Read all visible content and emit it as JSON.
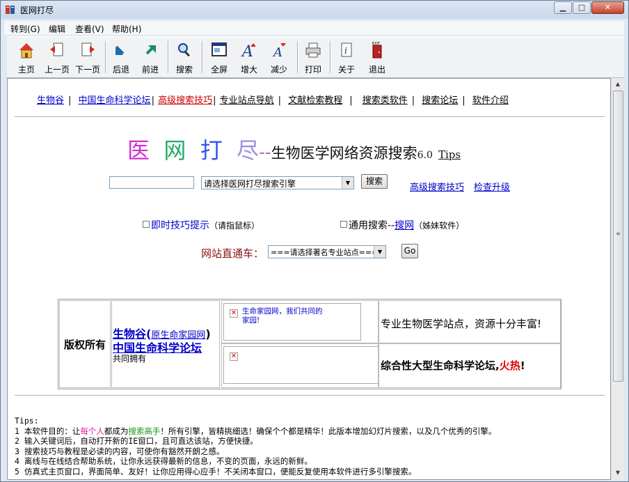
{
  "window": {
    "title": "医网打尽"
  },
  "menu": [
    "转到(G)",
    "编辑",
    "查看(V)",
    "帮助(H)"
  ],
  "toolbar": [
    "主页",
    "上一页",
    "下一页",
    "后退",
    "前进",
    "搜索",
    "全屏",
    "增大",
    "减少",
    "打印",
    "关于",
    "退出"
  ],
  "nav": [
    "生物谷",
    "中国生命科学论坛",
    "高级搜索技巧",
    "专业站点导航",
    "文献检索教程",
    "搜索类软件",
    "搜索论坛",
    "软件介绍"
  ],
  "logo": {
    "c1": "医",
    "c2": "网",
    "c3": "打",
    "c4": "尽",
    "dash": "--",
    "subtitle": "生物医学网络资源搜索",
    "version": "6.0",
    "tips": "Tips"
  },
  "search": {
    "engine_select": "请选择医网打尽搜索引擎",
    "button": "搜索",
    "advanced_link": "高级搜索技巧",
    "upgrade_link": "检查升级"
  },
  "options": {
    "instant_tips": "即时技巧提示",
    "instant_tips_note": "（请指鼠标）",
    "general_search": "通用搜索--",
    "sowang": "搜网",
    "sowang_note": "（姊妹软件）"
  },
  "direct": {
    "label": "网站直通车：",
    "select": "===请选择著名专业站点===",
    "go": "Go"
  },
  "table": {
    "copyright": "版权所有",
    "site1": "生物谷",
    "paren_open": "(",
    "site1_alt": "原生命家园网",
    "paren_close": ")",
    "site2": "中国生命科学论坛",
    "shared": "共同拥有",
    "img1_alt": "生命家园网，我们共同的家园!",
    "desc1": "专业生物医学站点，资源十分丰富!",
    "desc2_a": "综合性大型生命科学论坛,",
    "desc2_hot": "火热",
    "desc2_b": "!"
  },
  "tips": {
    "heading": "Tips:",
    "l1_a": "1 本软件目的：让",
    "l1_pink": "每个人",
    "l1_b": "都成为",
    "l1_green": "搜索高手",
    "l1_c": "！所有引擎，皆精挑细选！确保个个都是精华！此版本增加幻灯片搜索，以及几个优秀的引擎。",
    "l2": "2 输入关键词后，自动打开新的IE窗口，且可直达该站，方便快捷。",
    "l3": "3 搜索技巧与教程是必读的内容，可使你有豁然开朗之感。",
    "l4": "4 离线与在线结合帮助系统，让你永远获得最新的信息，不变的页面，永远的新鲜。",
    "l5": "5 仿真式主页窗口，界面简单、友好！让你应用得心应手！不关闭本窗口，便能反复使用本软件进行多引擎搜索。"
  }
}
